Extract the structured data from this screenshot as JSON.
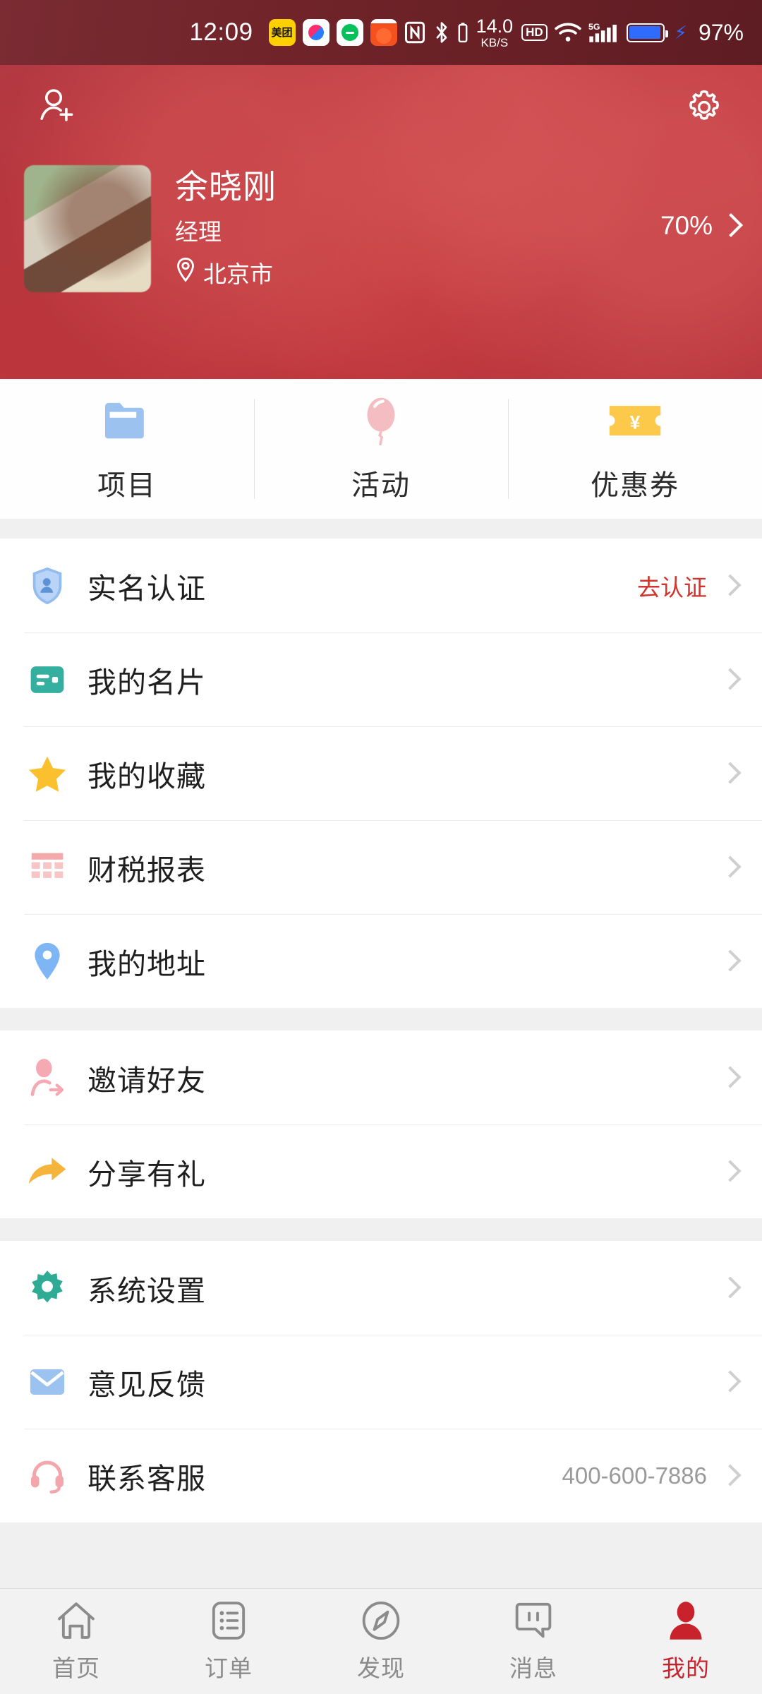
{
  "status_bar": {
    "time": "12:09",
    "app_icons": [
      "meituan-icon",
      "pinduoduo-icon",
      "message-app-icon",
      "taobao-icon"
    ],
    "meituan_text": "美团",
    "nfc_icon": "nfc-icon",
    "bluetooth_icon": "bluetooth-icon",
    "network_speed_value": "14.0",
    "network_speed_unit": "KB/S",
    "hd_label": "HD",
    "wifi_icon": "wifi-icon",
    "signal_label": "5G",
    "battery_percent": "97%",
    "charging_icon": "lightning-bolt-icon"
  },
  "header": {
    "add_friend_icon": "add-user-icon",
    "settings_icon": "gear-icon",
    "name": "余晓刚",
    "role": "经理",
    "location": "北京市",
    "location_icon": "map-pin-icon",
    "completion": "70%",
    "chevron_icon": "chevron-right-icon",
    "bg_color": "#bf3a40"
  },
  "quick_actions": [
    {
      "label": "项目",
      "icon": "folder-icon",
      "color": "#9cc2f0"
    },
    {
      "label": "活动",
      "icon": "balloon-icon",
      "color": "#f4bdc2"
    },
    {
      "label": "优惠券",
      "icon": "coupon-icon",
      "color": "#fcc94a"
    }
  ],
  "menu_groups": [
    {
      "items": [
        {
          "label": "实名认证",
          "icon": "shield-verify-icon",
          "color": "#93bdf0",
          "value": "去认证",
          "value_style": "alert"
        },
        {
          "label": "我的名片",
          "icon": "business-card-icon",
          "color": "#35b0a0",
          "value": ""
        },
        {
          "label": "我的收藏",
          "icon": "star-icon",
          "color": "#fbc02d",
          "value": ""
        },
        {
          "label": "财税报表",
          "icon": "table-report-icon",
          "color": "#f4a9ab",
          "value": ""
        },
        {
          "label": "我的地址",
          "icon": "map-pin-icon",
          "color": "#7eb6f5",
          "value": ""
        }
      ]
    },
    {
      "items": [
        {
          "label": "邀请好友",
          "icon": "invite-friend-icon",
          "color": "#f4a9b3",
          "value": ""
        },
        {
          "label": "分享有礼",
          "icon": "share-arrow-icon",
          "color": "#f5b43c",
          "value": ""
        }
      ]
    },
    {
      "items": [
        {
          "label": "系统设置",
          "icon": "gear-icon",
          "color": "#2eab94",
          "value": ""
        },
        {
          "label": "意见反馈",
          "icon": "envelope-icon",
          "color": "#9cc2f0",
          "value": ""
        },
        {
          "label": "联系客服",
          "icon": "headset-icon",
          "color": "#f3a6ac",
          "value": "400-600-7886"
        }
      ]
    }
  ],
  "tabbar": {
    "items": [
      {
        "label": "首页",
        "icon": "home-icon",
        "active": false
      },
      {
        "label": "订单",
        "icon": "order-list-icon",
        "active": false
      },
      {
        "label": "发现",
        "icon": "compass-icon",
        "active": false
      },
      {
        "label": "消息",
        "icon": "chat-bubble-icon",
        "active": false
      },
      {
        "label": "我的",
        "icon": "user-icon",
        "active": true
      }
    ],
    "active_color": "#c8232c",
    "inactive_color": "#8b8b8b"
  }
}
